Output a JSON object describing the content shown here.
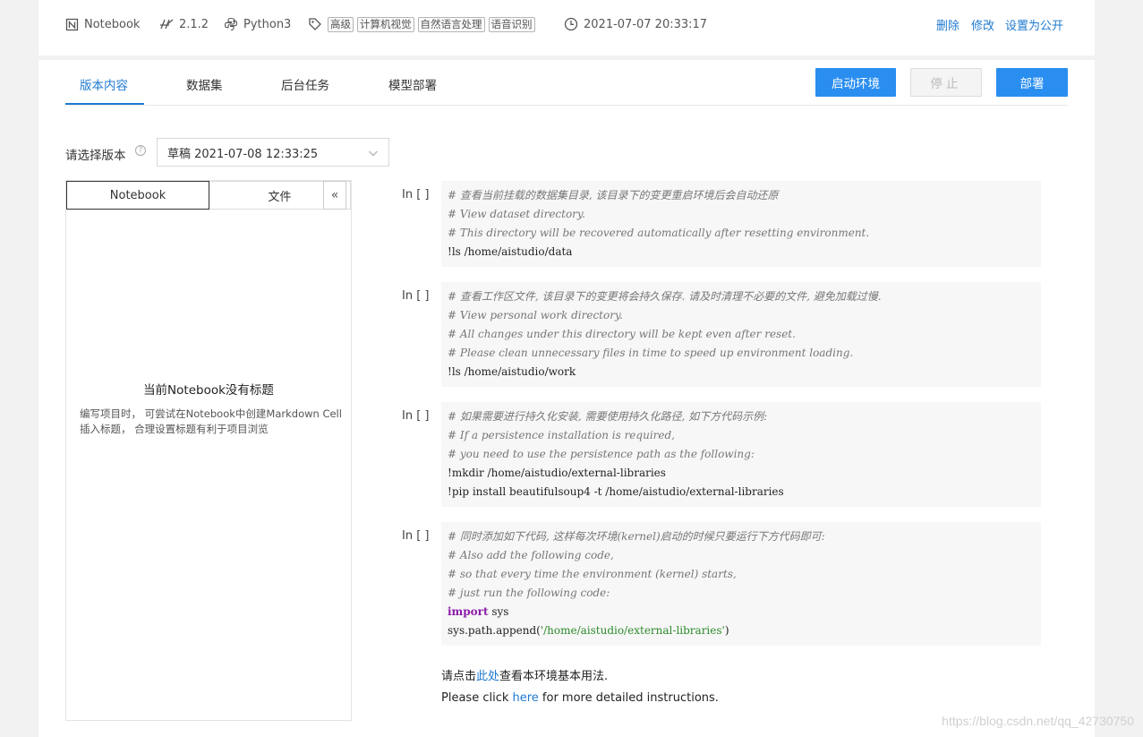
{
  "meta": {
    "type": "Notebook",
    "version": "2.1.2",
    "env": "Python3",
    "tags": [
      "高级",
      "计算机视觉",
      "自然语言处理",
      "语音识别"
    ],
    "datetime": "2021-07-07 20:33:17",
    "actions": {
      "delete": "删除",
      "edit": "修改",
      "make_public": "设置为公开"
    }
  },
  "tabs": [
    "版本内容",
    "数据集",
    "后台任务",
    "模型部署"
  ],
  "buttons": {
    "start": "启动环境",
    "stop": "停止",
    "deploy": "部署"
  },
  "version_select": {
    "label": "请选择版本",
    "help": "?",
    "value": "草稿 2021-07-08 12:33:25"
  },
  "sidebar": {
    "tabs": [
      "Notebook",
      "文件"
    ],
    "collapse": "«",
    "empty_title": "当前Notebook没有标题",
    "empty_desc": "编写项目时， 可尝试在Notebook中创建Markdown Cell插入标题， 合理设置标题有利于项目浏览"
  },
  "cells": [
    {
      "prompt": "In [ ]",
      "lines": [
        {
          "text": "# 查看当前挂载的数据集目录, 该目录下的变更重启环境后会自动还原",
          "type": "comment"
        },
        {
          "text": "# View dataset directory.",
          "type": "comment"
        },
        {
          "text": "# This directory will be recovered automatically after resetting environment.",
          "type": "comment"
        },
        {
          "text": "!ls /home/aistudio/data",
          "type": "code"
        }
      ]
    },
    {
      "prompt": "In [ ]",
      "lines": [
        {
          "text": "# 查看工作区文件, 该目录下的变更将会持久保存. 请及时清理不必要的文件, 避免加载过慢.",
          "type": "comment"
        },
        {
          "text": "# View personal work directory.",
          "type": "comment"
        },
        {
          "text": "# All changes under this directory will be kept even after reset.",
          "type": "comment"
        },
        {
          "text": "# Please clean unnecessary files in time to speed up environment loading.",
          "type": "comment"
        },
        {
          "text": "!ls /home/aistudio/work",
          "type": "code"
        }
      ]
    },
    {
      "prompt": "In [ ]",
      "lines": [
        {
          "text": "# 如果需要进行持久化安装, 需要使用持久化路径, 如下方代码示例:",
          "type": "comment"
        },
        {
          "text": "# If a persistence installation is required,",
          "type": "comment"
        },
        {
          "text": "# you need to use the persistence path as the following:",
          "type": "comment"
        },
        {
          "text": "!mkdir /home/aistudio/external-libraries",
          "type": "code"
        },
        {
          "text": "!pip install beautifulsoup4 -t /home/aistudio/external-libraries",
          "type": "code"
        }
      ]
    },
    {
      "prompt": "In [ ]",
      "lines": [
        {
          "text": "# 同时添加如下代码, 这样每次环境(kernel)启动的时候只要运行下方代码即可:",
          "type": "comment"
        },
        {
          "text": "# Also add the following code,",
          "type": "comment"
        },
        {
          "text": "# so that every time the environment (kernel) starts,",
          "type": "comment"
        },
        {
          "text": "# just run the following code:",
          "type": "comment"
        },
        {
          "keyword": "import",
          "rest": " sys",
          "type": "import"
        },
        {
          "prefix": "sys.path.append(",
          "string": "'/home/aistudio/external-libraries'",
          "suffix": ")",
          "type": "call"
        }
      ]
    }
  ],
  "footer": {
    "cn_before": "请点击",
    "cn_link": "此处",
    "cn_after": "查看本环境基本用法.",
    "en_before": "Please click ",
    "en_link": "here",
    "en_after": " for more detailed instructions."
  },
  "watermark": "https://blog.csdn.net/qq_42730750"
}
